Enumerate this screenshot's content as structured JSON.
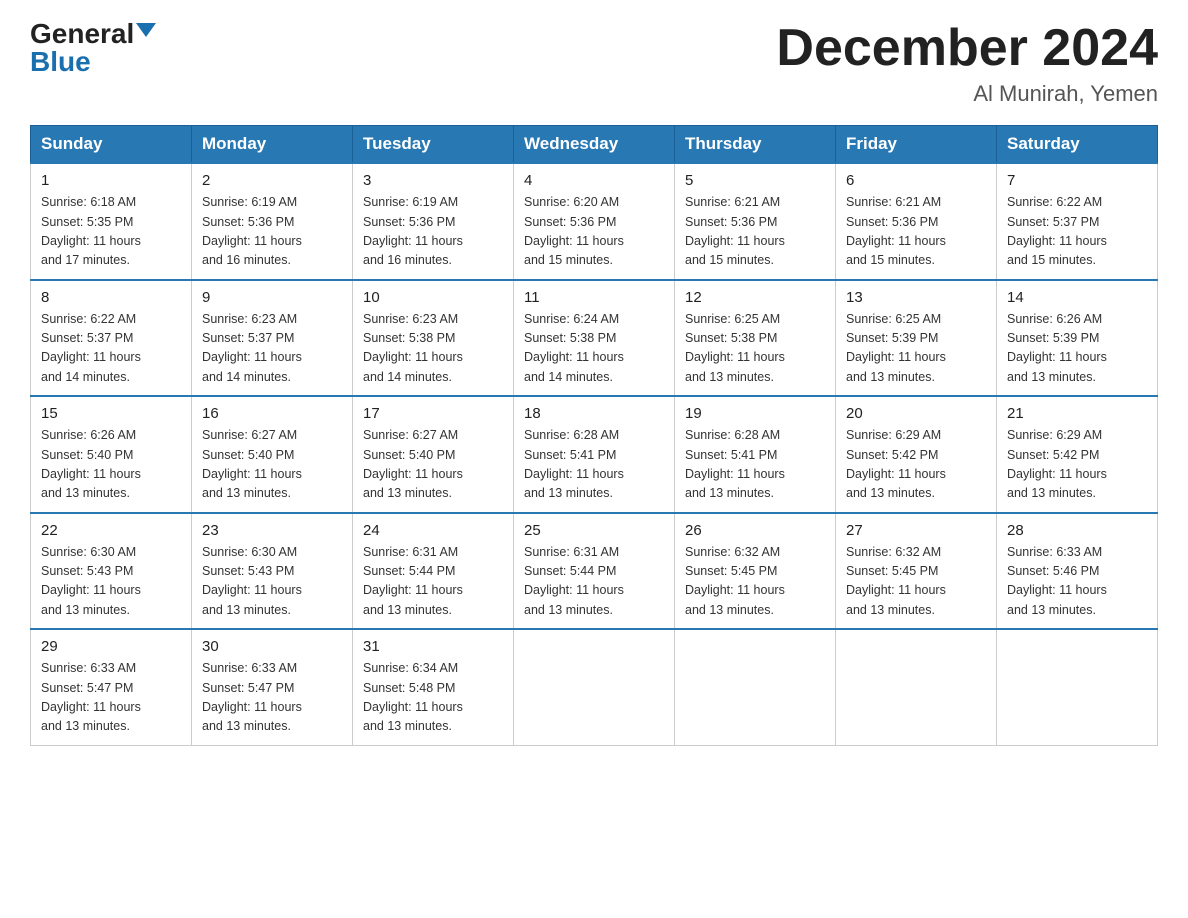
{
  "header": {
    "logo_general": "General",
    "logo_blue": "Blue",
    "month_title": "December 2024",
    "location": "Al Munirah, Yemen"
  },
  "days_of_week": [
    "Sunday",
    "Monday",
    "Tuesday",
    "Wednesday",
    "Thursday",
    "Friday",
    "Saturday"
  ],
  "weeks": [
    [
      {
        "day": "1",
        "sunrise": "6:18 AM",
        "sunset": "5:35 PM",
        "daylight": "11 hours and 17 minutes."
      },
      {
        "day": "2",
        "sunrise": "6:19 AM",
        "sunset": "5:36 PM",
        "daylight": "11 hours and 16 minutes."
      },
      {
        "day": "3",
        "sunrise": "6:19 AM",
        "sunset": "5:36 PM",
        "daylight": "11 hours and 16 minutes."
      },
      {
        "day": "4",
        "sunrise": "6:20 AM",
        "sunset": "5:36 PM",
        "daylight": "11 hours and 15 minutes."
      },
      {
        "day": "5",
        "sunrise": "6:21 AM",
        "sunset": "5:36 PM",
        "daylight": "11 hours and 15 minutes."
      },
      {
        "day": "6",
        "sunrise": "6:21 AM",
        "sunset": "5:36 PM",
        "daylight": "11 hours and 15 minutes."
      },
      {
        "day": "7",
        "sunrise": "6:22 AM",
        "sunset": "5:37 PM",
        "daylight": "11 hours and 15 minutes."
      }
    ],
    [
      {
        "day": "8",
        "sunrise": "6:22 AM",
        "sunset": "5:37 PM",
        "daylight": "11 hours and 14 minutes."
      },
      {
        "day": "9",
        "sunrise": "6:23 AM",
        "sunset": "5:37 PM",
        "daylight": "11 hours and 14 minutes."
      },
      {
        "day": "10",
        "sunrise": "6:23 AM",
        "sunset": "5:38 PM",
        "daylight": "11 hours and 14 minutes."
      },
      {
        "day": "11",
        "sunrise": "6:24 AM",
        "sunset": "5:38 PM",
        "daylight": "11 hours and 14 minutes."
      },
      {
        "day": "12",
        "sunrise": "6:25 AM",
        "sunset": "5:38 PM",
        "daylight": "11 hours and 13 minutes."
      },
      {
        "day": "13",
        "sunrise": "6:25 AM",
        "sunset": "5:39 PM",
        "daylight": "11 hours and 13 minutes."
      },
      {
        "day": "14",
        "sunrise": "6:26 AM",
        "sunset": "5:39 PM",
        "daylight": "11 hours and 13 minutes."
      }
    ],
    [
      {
        "day": "15",
        "sunrise": "6:26 AM",
        "sunset": "5:40 PM",
        "daylight": "11 hours and 13 minutes."
      },
      {
        "day": "16",
        "sunrise": "6:27 AM",
        "sunset": "5:40 PM",
        "daylight": "11 hours and 13 minutes."
      },
      {
        "day": "17",
        "sunrise": "6:27 AM",
        "sunset": "5:40 PM",
        "daylight": "11 hours and 13 minutes."
      },
      {
        "day": "18",
        "sunrise": "6:28 AM",
        "sunset": "5:41 PM",
        "daylight": "11 hours and 13 minutes."
      },
      {
        "day": "19",
        "sunrise": "6:28 AM",
        "sunset": "5:41 PM",
        "daylight": "11 hours and 13 minutes."
      },
      {
        "day": "20",
        "sunrise": "6:29 AM",
        "sunset": "5:42 PM",
        "daylight": "11 hours and 13 minutes."
      },
      {
        "day": "21",
        "sunrise": "6:29 AM",
        "sunset": "5:42 PM",
        "daylight": "11 hours and 13 minutes."
      }
    ],
    [
      {
        "day": "22",
        "sunrise": "6:30 AM",
        "sunset": "5:43 PM",
        "daylight": "11 hours and 13 minutes."
      },
      {
        "day": "23",
        "sunrise": "6:30 AM",
        "sunset": "5:43 PM",
        "daylight": "11 hours and 13 minutes."
      },
      {
        "day": "24",
        "sunrise": "6:31 AM",
        "sunset": "5:44 PM",
        "daylight": "11 hours and 13 minutes."
      },
      {
        "day": "25",
        "sunrise": "6:31 AM",
        "sunset": "5:44 PM",
        "daylight": "11 hours and 13 minutes."
      },
      {
        "day": "26",
        "sunrise": "6:32 AM",
        "sunset": "5:45 PM",
        "daylight": "11 hours and 13 minutes."
      },
      {
        "day": "27",
        "sunrise": "6:32 AM",
        "sunset": "5:45 PM",
        "daylight": "11 hours and 13 minutes."
      },
      {
        "day": "28",
        "sunrise": "6:33 AM",
        "sunset": "5:46 PM",
        "daylight": "11 hours and 13 minutes."
      }
    ],
    [
      {
        "day": "29",
        "sunrise": "6:33 AM",
        "sunset": "5:47 PM",
        "daylight": "11 hours and 13 minutes."
      },
      {
        "day": "30",
        "sunrise": "6:33 AM",
        "sunset": "5:47 PM",
        "daylight": "11 hours and 13 minutes."
      },
      {
        "day": "31",
        "sunrise": "6:34 AM",
        "sunset": "5:48 PM",
        "daylight": "11 hours and 13 minutes."
      },
      null,
      null,
      null,
      null
    ]
  ],
  "labels": {
    "sunrise": "Sunrise:",
    "sunset": "Sunset:",
    "daylight": "Daylight:"
  }
}
